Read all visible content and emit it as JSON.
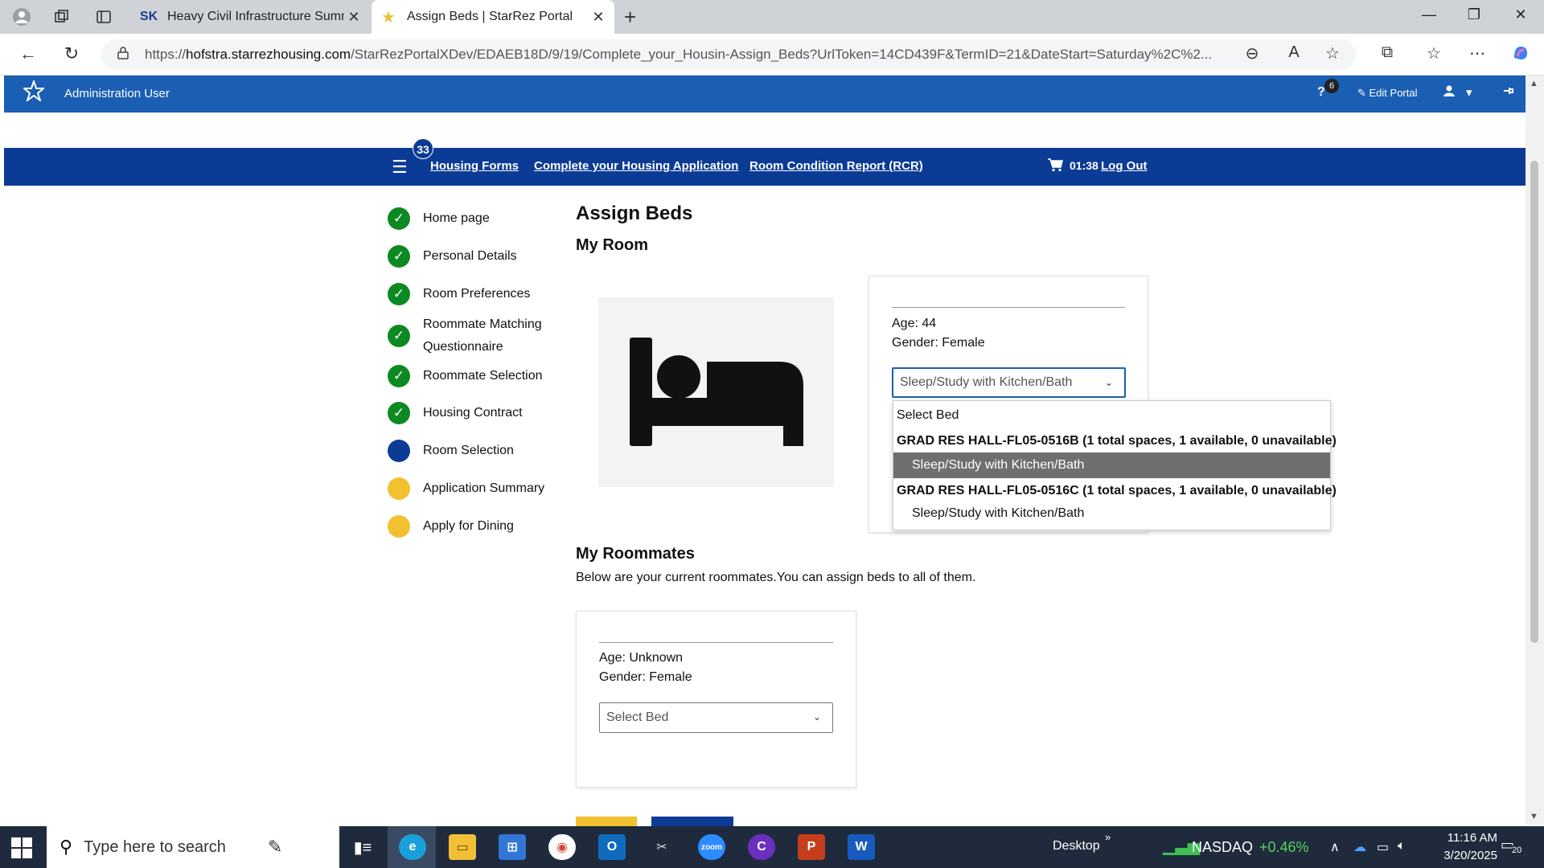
{
  "browser": {
    "tabs": [
      {
        "title": "Heavy Civil Infrastructure Summe",
        "favicon": "sk-logo-icon",
        "active": false
      },
      {
        "title": "Assign Beds | StarRez Portal",
        "favicon": "star-icon",
        "active": true
      }
    ],
    "url_host": "hofstra.starrezhousing.com",
    "url_prefix": "https://",
    "url_path": "/StarRezPortalXDev/EDAEB18D/9/19/Complete_your_Housin-Assign_Beds?UrlToken=14CD439F&TermID=21&DateStart=Saturday%2C%2..."
  },
  "admin_bar": {
    "user": "Administration User",
    "help_count": "6",
    "edit_label": "Edit Portal",
    "brand_color": "#1a5fb4"
  },
  "main_nav": {
    "badge": "33",
    "links": [
      "Housing Forms",
      "Complete your Housing Application",
      "Room Condition Report (RCR)"
    ],
    "timer": "01:38",
    "logout": "Log Out",
    "color": "#0b3b95"
  },
  "steps": [
    {
      "label": "Home page",
      "status": "done"
    },
    {
      "label": "Personal Details",
      "status": "done"
    },
    {
      "label": "Room Preferences",
      "status": "done"
    },
    {
      "label": "Roommate Matching Questionnaire",
      "status": "done"
    },
    {
      "label": "Roommate Selection",
      "status": "done"
    },
    {
      "label": "Housing Contract",
      "status": "done"
    },
    {
      "label": "Room Selection",
      "status": "current"
    },
    {
      "label": "Application Summary",
      "status": "todo"
    },
    {
      "label": "Apply for Dining",
      "status": "todo"
    }
  ],
  "page": {
    "title": "Assign Beds",
    "my_room_heading": "My Room",
    "my_card": {
      "age": "Age: 44",
      "gender": "Gender: Female",
      "selected_bed": "Sleep/Study with Kitchen/Bath"
    },
    "dropdown": {
      "placeholder": "Select Bed",
      "groups": [
        {
          "label": "GRAD RES HALL-FL05-0516B (1 total spaces, 1 available, 0 unavailable)",
          "option": "Sleep/Study with Kitchen/Bath",
          "selected": true
        },
        {
          "label": "GRAD RES HALL-FL05-0516C (1 total spaces, 1 available, 0 unavailable)",
          "option": "Sleep/Study with Kitchen/Bath",
          "selected": false
        }
      ]
    },
    "roommates_heading": "My Roommates",
    "roommates_intro": "Below are your current roommates.You can assign beds to all of them.",
    "roommate_card": {
      "age": "Age: Unknown",
      "gender": "Gender: Female",
      "select_placeholder": "Select Bed"
    }
  },
  "taskbar": {
    "search_placeholder": "Type here to search",
    "desktop_label": "Desktop",
    "ticker_name": "NASDAQ",
    "ticker_change": "+0.46%",
    "time": "11:16 AM",
    "date": "3/20/2025",
    "notifications": "20"
  }
}
